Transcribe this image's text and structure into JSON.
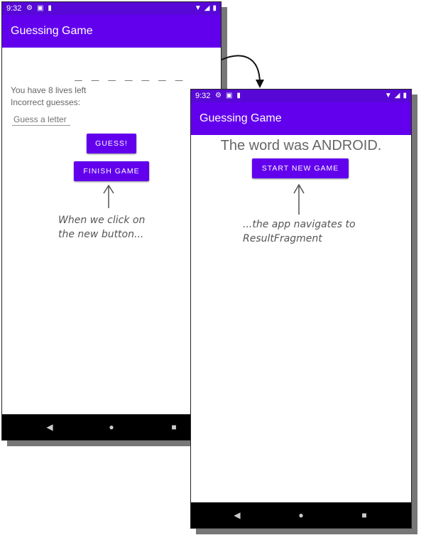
{
  "left_screen": {
    "status": {
      "time": "9:32"
    },
    "app_title": "Guessing Game",
    "secret_word_mask": "_ _ _ _ _ _ _",
    "lives_text": "You have 8 lives left",
    "incorrect_text": "Incorrect guesses:",
    "guess_input": {
      "placeholder": "Guess a letter",
      "value": ""
    },
    "guess_button": "GUESS!",
    "finish_button": "FINISH GAME"
  },
  "right_screen": {
    "status": {
      "time": "9:32"
    },
    "app_title": "Guessing Game",
    "result_text": "The word was ANDROID.",
    "start_button": "START NEW GAME"
  },
  "annotations": {
    "note1_line1": "When we click on",
    "note1_line2": "the new button...",
    "note2_line1": "...the app navigates to",
    "note2_line2": "ResultFragment"
  },
  "colors": {
    "primary": "#6200ee",
    "status_bar": "#5708d6",
    "nav_bar": "#000000"
  }
}
